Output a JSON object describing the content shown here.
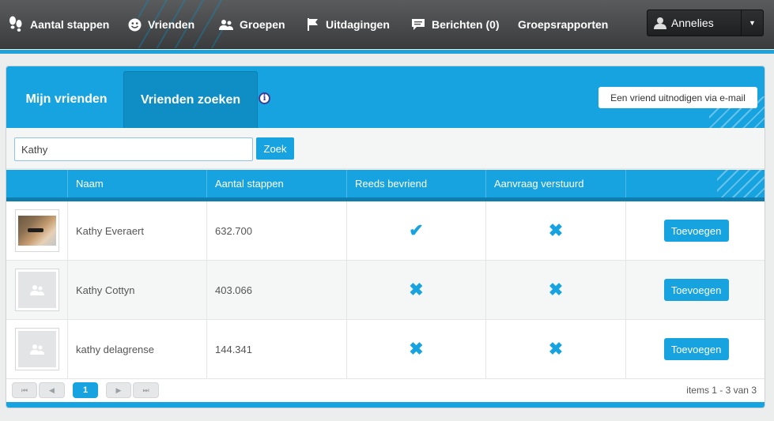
{
  "nav": {
    "items": [
      {
        "label": "Aantal stappen",
        "icon": "footsteps-icon"
      },
      {
        "label": "Vrienden",
        "icon": "smiley-icon"
      },
      {
        "label": "Groepen",
        "icon": "group-icon"
      },
      {
        "label": "Uitdagingen",
        "icon": "flag-icon"
      },
      {
        "label": "Berichten (0)",
        "icon": "message-icon"
      },
      {
        "label": "Groepsrapporten",
        "icon": ""
      }
    ],
    "user": {
      "name": "Annelies"
    }
  },
  "tabs": {
    "t1": "Mijn vrienden",
    "t2": "Vrienden zoeken",
    "info": "i"
  },
  "invite_label": "Een vriend uitnodigen via e-mail",
  "search": {
    "value": "Kathy",
    "button": "Zoek"
  },
  "table": {
    "headers": [
      "",
      "Naam",
      "Aantal stappen",
      "Reeds bevriend",
      "Aanvraag verstuurd",
      ""
    ],
    "rows": [
      {
        "name": "Kathy Everaert",
        "steps": "632.700",
        "friends": "yes",
        "requested": "no",
        "action": "Toevoegen",
        "photo": "photo"
      },
      {
        "name": "Kathy Cottyn",
        "steps": "403.066",
        "friends": "no",
        "requested": "no",
        "action": "Toevoegen",
        "photo": "placeholder"
      },
      {
        "name": "kathy delagrense",
        "steps": "144.341",
        "friends": "no",
        "requested": "no",
        "action": "Toevoegen",
        "photo": "placeholder"
      }
    ]
  },
  "pager": {
    "current": "1",
    "info": "items 1 - 3 van 3"
  },
  "colors": {
    "accent": "#17a3df",
    "nav_bg": "#4a4b4d"
  }
}
